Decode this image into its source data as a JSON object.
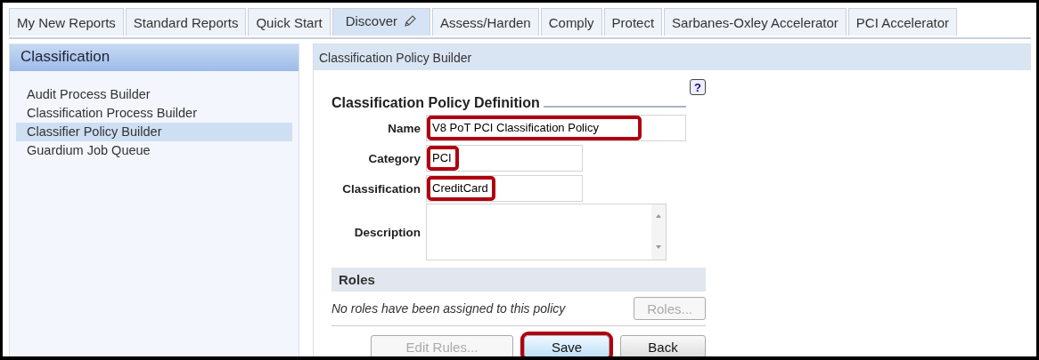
{
  "tabs": [
    {
      "label": "My New Reports",
      "selected": false
    },
    {
      "label": "Standard Reports",
      "selected": false
    },
    {
      "label": "Quick Start",
      "selected": false
    },
    {
      "label": "Discover",
      "selected": true,
      "edit_icon": true
    },
    {
      "label": "Assess/Harden",
      "selected": false
    },
    {
      "label": "Comply",
      "selected": false
    },
    {
      "label": "Protect",
      "selected": false
    },
    {
      "label": "Sarbanes-Oxley Accelerator",
      "selected": false
    },
    {
      "label": "PCI Accelerator",
      "selected": false
    }
  ],
  "sidebar": {
    "title": "Classification",
    "items": [
      {
        "label": "Audit Process Builder",
        "selected": false
      },
      {
        "label": "Classification Process Builder",
        "selected": false
      },
      {
        "label": "Classifier Policy Builder",
        "selected": true
      },
      {
        "label": "Guardium Job Queue",
        "selected": false
      }
    ]
  },
  "panel": {
    "title": "Classification Policy Builder",
    "section_title": "Classification Policy Definition",
    "help_label": "?",
    "fields": [
      {
        "kind": "longtext",
        "label": "Name",
        "value": "V8 PoT PCI Classification Policy",
        "highlighted": true
      },
      {
        "kind": "text",
        "label": "Category",
        "value": "PCI",
        "highlighted": true
      },
      {
        "kind": "text",
        "label": "Classification",
        "value": "CreditCard",
        "highlighted": true
      },
      {
        "kind": "textarea",
        "label": "Description",
        "highlighted": false
      }
    ],
    "roles": {
      "title": "Roles",
      "message": "No roles have been assigned to this policy",
      "button": {
        "label": "Roles...",
        "disabled": true
      }
    },
    "buttons": [
      {
        "label": "Edit Rules...",
        "disabled": true,
        "highlighted": false,
        "primary": false
      },
      {
        "label": "Save",
        "disabled": false,
        "highlighted": true,
        "primary": true
      },
      {
        "label": "Back",
        "disabled": false,
        "highlighted": false,
        "primary": false
      }
    ]
  }
}
